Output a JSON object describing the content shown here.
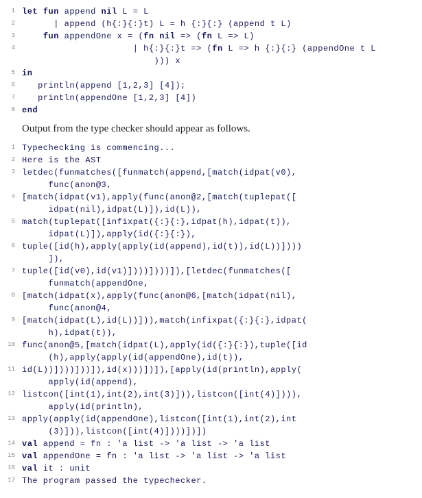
{
  "block1": {
    "lines": [
      {
        "n": "1",
        "t": "let fun append nil L = L",
        "kw": [
          "let",
          "fun",
          "nil"
        ]
      },
      {
        "n": "2",
        "t": "      | append (h{:}{:}t) L = h {:}{:} (append t L)"
      },
      {
        "n": "3",
        "t": "    fun appendOne x = (fn nil => (fn L => L)",
        "kw": [
          "fun",
          "fn",
          "nil",
          "fn"
        ]
      },
      {
        "n": "4",
        "t": "                     | h{:}{:}t => (fn L => h {:}{:} (appendOne t L",
        "kw": [
          "fn"
        ]
      },
      {
        "n": "",
        "t": "                         ))) x"
      },
      {
        "n": "5",
        "t": "in",
        "kw": [
          "in"
        ]
      },
      {
        "n": "6",
        "t": "   println(append [1,2,3] [4]);"
      },
      {
        "n": "7",
        "t": "   println(appendOne [1,2,3] [4])"
      },
      {
        "n": "8",
        "t": "end",
        "kw": [
          "end"
        ]
      }
    ]
  },
  "prose_text": "Output from the type checker should appear as follows.",
  "block2": {
    "lines": [
      {
        "n": "1",
        "t": "Typechecking is commencing..."
      },
      {
        "n": "2",
        "t": "Here is the AST"
      },
      {
        "n": "3",
        "t": "letdec(funmatches([funmatch(append,[match(idpat(v0),",
        "c": "     func(anon@3,"
      },
      {
        "n": "4",
        "t": "[match(idpat(v1),apply(func(anon@2,[match(tuplepat([",
        "c": "     idpat(nil),idpat(L)]),id(L)),"
      },
      {
        "n": "5",
        "t": "match(tuplepat([infixpat({:}{:},idpat(h),idpat(t)),",
        "c": "     idpat(L)]),apply(id({:}{:}),"
      },
      {
        "n": "6",
        "t": "tuple([id(h),apply(apply(id(append),id(t)),id(L))])))",
        "c": "     ]),"
      },
      {
        "n": "7",
        "t": "tuple([id(v0),id(v1)])))])))]),[letdec(funmatches([",
        "c": "     funmatch(appendOne,"
      },
      {
        "n": "8",
        "t": "[match(idpat(x),apply(func(anon@6,[match(idpat(nil),",
        "c": "     func(anon@4,"
      },
      {
        "n": "9",
        "t": "[match(idpat(L),id(L))])),match(infixpat({:}{:},idpat(",
        "c": "     h),idpat(t)),"
      },
      {
        "n": "10",
        "t": "func(anon@5,[match(idpat(L),apply(id({:}{:}),tuple([id",
        "c": "     (h),apply(apply(id(appendOne),id(t)),"
      },
      {
        "n": "11",
        "t": "id(L))])))]))]),id(x)))])]),[apply(id(println),apply(",
        "c": "     apply(id(append),"
      },
      {
        "n": "12",
        "t": "listcon([int(1),int(2),int(3)])),listcon([int(4)]))),",
        "c": "     apply(id(println),"
      },
      {
        "n": "13",
        "t": "apply(apply(id(appendOne),listcon([int(1),int(2),int",
        "c": "     (3)])),listcon([int(4)])))])])"
      },
      {
        "n": "14",
        "t": "val append = fn : 'a list -> 'a list -> 'a list",
        "kw": [
          "val"
        ]
      },
      {
        "n": "15",
        "t": "val appendOne = fn : 'a list -> 'a list -> 'a list",
        "kw": [
          "val"
        ]
      },
      {
        "n": "16",
        "t": "val it : unit",
        "kw": [
          "val"
        ]
      },
      {
        "n": "17",
        "t": "The program passed the typechecker."
      }
    ]
  }
}
